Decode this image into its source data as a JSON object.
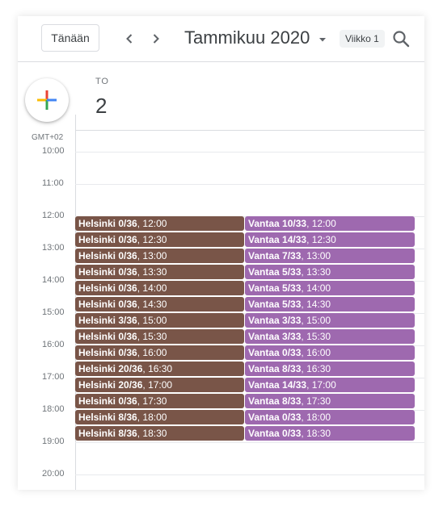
{
  "toolbar": {
    "today_label": "Tänään",
    "title": "Tammikuu 2020",
    "week_label": "Viikko 1"
  },
  "day": {
    "name": "TO",
    "number": "2"
  },
  "timezone": "GMT+02",
  "hours": [
    "10:00",
    "11:00",
    "12:00",
    "13:00",
    "14:00",
    "15:00",
    "16:00",
    "17:00",
    "18:00",
    "19:00",
    "20:00"
  ],
  "helsinki_events": [
    {
      "label": "Helsinki 0/36",
      "time": "12:00"
    },
    {
      "label": "Helsinki 0/36",
      "time": "12:30"
    },
    {
      "label": "Helsinki 0/36",
      "time": "13:00"
    },
    {
      "label": "Helsinki 0/36",
      "time": "13:30"
    },
    {
      "label": "Helsinki 0/36",
      "time": "14:00"
    },
    {
      "label": "Helsinki 0/36",
      "time": "14:30"
    },
    {
      "label": "Helsinki 3/36",
      "time": "15:00"
    },
    {
      "label": "Helsinki 0/36",
      "time": "15:30"
    },
    {
      "label": "Helsinki 0/36",
      "time": "16:00"
    },
    {
      "label": "Helsinki 20/36",
      "time": "16:30"
    },
    {
      "label": "Helsinki 20/36",
      "time": "17:00"
    },
    {
      "label": "Helsinki 0/36",
      "time": "17:30"
    },
    {
      "label": "Helsinki 8/36",
      "time": "18:00"
    },
    {
      "label": "Helsinki 8/36",
      "time": "18:30"
    }
  ],
  "vantaa_events": [
    {
      "label": "Vantaa 10/33",
      "time": "12:00"
    },
    {
      "label": "Vantaa 14/33",
      "time": "12:30"
    },
    {
      "label": "Vantaa 7/33",
      "time": "13:00"
    },
    {
      "label": "Vantaa 5/33",
      "time": "13:30"
    },
    {
      "label": "Vantaa 5/33",
      "time": "14:00"
    },
    {
      "label": "Vantaa 5/33",
      "time": "14:30"
    },
    {
      "label": "Vantaa 3/33",
      "time": "15:00"
    },
    {
      "label": "Vantaa 3/33",
      "time": "15:30"
    },
    {
      "label": "Vantaa 0/33",
      "time": "16:00"
    },
    {
      "label": "Vantaa 8/33",
      "time": "16:30"
    },
    {
      "label": "Vantaa 14/33",
      "time": "17:00"
    },
    {
      "label": "Vantaa 8/33",
      "time": "17:30"
    },
    {
      "label": "Vantaa 0/33",
      "time": "18:00"
    },
    {
      "label": "Vantaa 0/33",
      "time": "18:30"
    }
  ],
  "colors": {
    "helsinki": "#795548",
    "vantaa": "#9e69af"
  },
  "icons": {
    "create": "plus-icon",
    "prev": "chevron-left-icon",
    "next": "chevron-right-icon",
    "title_dropdown": "caret-down-icon",
    "search": "search-icon"
  }
}
